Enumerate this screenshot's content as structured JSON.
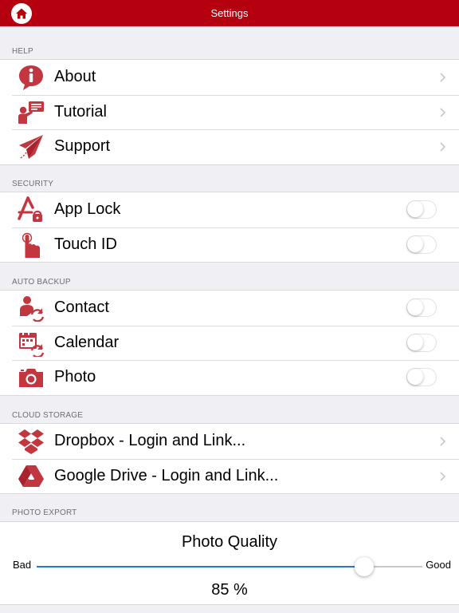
{
  "navbar": {
    "title": "Settings",
    "home_icon": "home-icon"
  },
  "colors": {
    "brand": "#b5000f",
    "icon": "#c2373f",
    "slider": "#1e7bd1"
  },
  "sections": {
    "help": {
      "header": "HELP",
      "rows": [
        {
          "label": "About",
          "icon": "info-icon"
        },
        {
          "label": "Tutorial",
          "icon": "presenter-icon"
        },
        {
          "label": "Support",
          "icon": "paper-plane-icon"
        }
      ]
    },
    "security": {
      "header": "SECURITY",
      "rows": [
        {
          "label": "App Lock",
          "icon": "app-lock-icon",
          "on": false
        },
        {
          "label": "Touch ID",
          "icon": "touch-icon",
          "on": false
        }
      ]
    },
    "backup": {
      "header": "AUTO BACKUP",
      "rows": [
        {
          "label": "Contact",
          "icon": "contact-sync-icon",
          "on": false
        },
        {
          "label": "Calendar",
          "icon": "calendar-sync-icon",
          "on": false
        },
        {
          "label": "Photo",
          "icon": "camera-icon",
          "on": false
        }
      ]
    },
    "cloud": {
      "header": "CLOUD STORAGE",
      "rows": [
        {
          "label": "Dropbox - Login and Link...",
          "icon": "dropbox-icon"
        },
        {
          "label": "Google Drive - Login and Link...",
          "icon": "google-drive-icon"
        }
      ]
    },
    "export": {
      "header": "PHOTO EXPORT",
      "quality_title": "Photo Quality",
      "min_label": "Bad",
      "max_label": "Good",
      "quality_percent": 85,
      "value_text": "85 %"
    }
  }
}
